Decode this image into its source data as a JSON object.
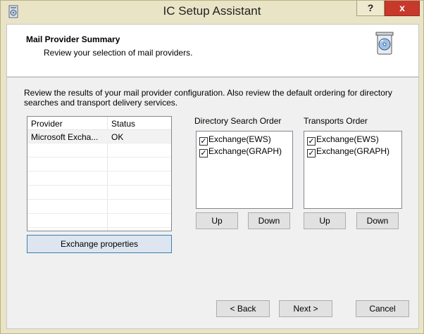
{
  "window": {
    "title": "IC Setup Assistant",
    "help_label": "?",
    "close_label": "x"
  },
  "header": {
    "title": "Mail Provider Summary",
    "subtitle": "Review your selection of mail providers."
  },
  "description": "Review the results of your mail provider configuration. Also review the default ordering for directory searches and transport delivery services.",
  "providers": {
    "columns": [
      "Provider",
      "Status"
    ],
    "rows": [
      {
        "provider": "Microsoft Excha...",
        "status": "OK"
      }
    ]
  },
  "buttons": {
    "exchange_properties": "Exchange properties",
    "dir_up": "Up",
    "dir_down": "Down",
    "tr_up": "Up",
    "tr_down": "Down",
    "back": "< Back",
    "next": "Next >",
    "cancel": "Cancel"
  },
  "directory_search_order": {
    "label": "Directory Search Order",
    "items": [
      {
        "label": "Exchange(EWS)",
        "checked": true
      },
      {
        "label": "Exchange(GRAPH)",
        "checked": true
      }
    ]
  },
  "transports_order": {
    "label": "Transports Order",
    "items": [
      {
        "label": "Exchange(EWS)",
        "checked": true
      },
      {
        "label": "Exchange(GRAPH)",
        "checked": true
      }
    ]
  },
  "icons": {
    "app": "setup-cd-icon",
    "header": "trashcan-cd-icon",
    "checkbox_mark": "✓"
  },
  "colors": {
    "titlebar_bg": "#e9e4c6",
    "close_red": "#c7392b",
    "focused_border": "#3c7fb1"
  }
}
